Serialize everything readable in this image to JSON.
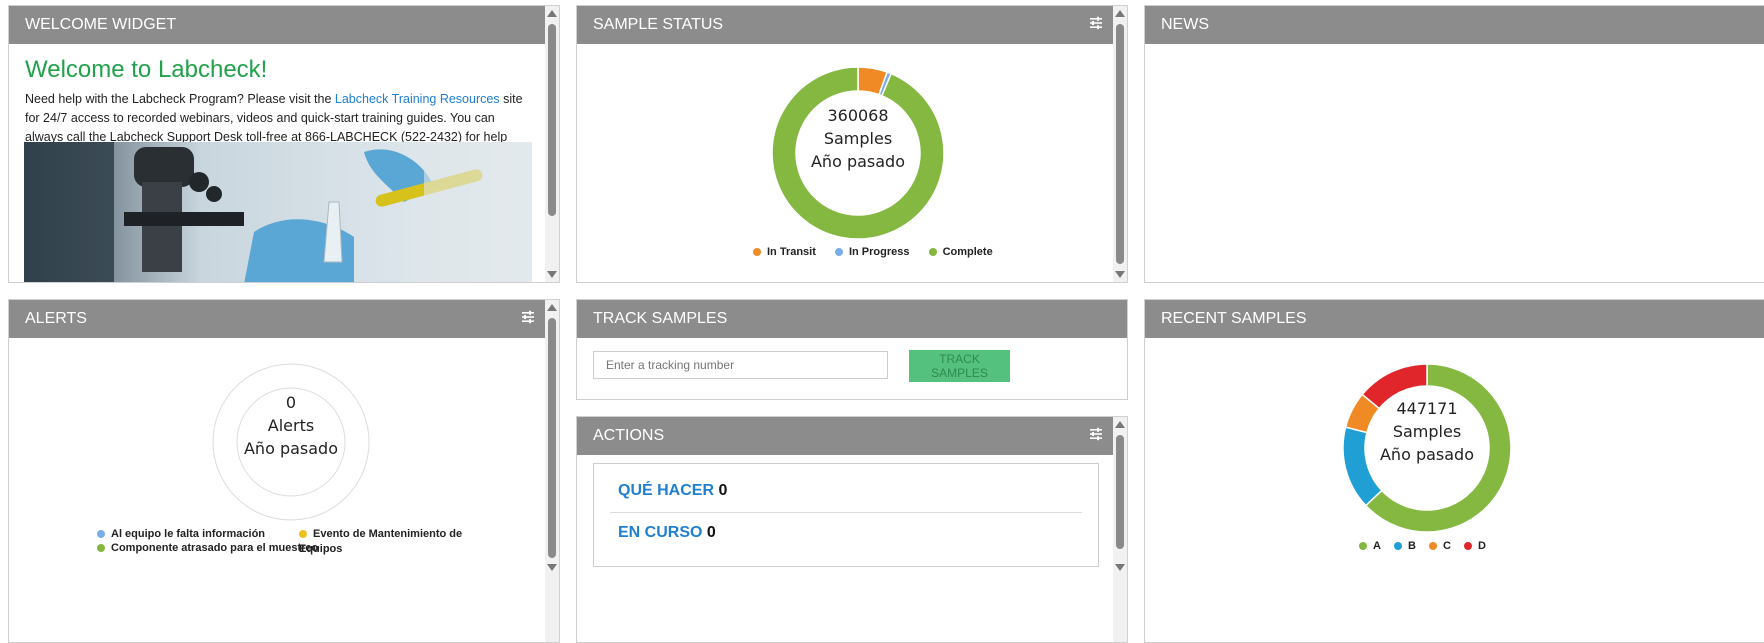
{
  "welcome": {
    "header": "WELCOME WIDGET",
    "title": "Welcome to Labcheck!",
    "text_before_link": "Need help with the Labcheck Program? Please visit the ",
    "link": "Labcheck Training Resources",
    "text_after_link": " site for 24/7 access to recorded webinars, videos and quick-start training guides. You can always call the Labcheck Support Desk toll-free at 866-LABCHECK (522-2432) for help with a personal touch. Thank you."
  },
  "sample_status": {
    "header": "SAMPLE STATUS",
    "count": "360068",
    "label": "Samples",
    "period": "Año pasado",
    "legend": [
      {
        "label": "In Transit",
        "color": "#f08a24"
      },
      {
        "label": "In Progress",
        "color": "#7aaee8"
      },
      {
        "label": "Complete",
        "color": "#84b840"
      }
    ]
  },
  "news": {
    "header": "NEWS"
  },
  "alerts": {
    "header": "ALERTS",
    "count": "0",
    "label": "Alerts",
    "period": "Año pasado",
    "legend": [
      {
        "label": "Al equipo le falta información",
        "color": "#7aaee8"
      },
      {
        "label": "Evento de Mantenimiento de Equipos",
        "color": "#f0c020"
      },
      {
        "label": "Componente atrasado para el muestreo",
        "color": "#84b840"
      }
    ]
  },
  "track": {
    "header": "TRACK SAMPLES",
    "placeholder": "Enter a tracking number",
    "button": "TRACK SAMPLES"
  },
  "actions": {
    "header": "ACTIONS",
    "rows": [
      {
        "label": "QUÉ HACER",
        "count": "0"
      },
      {
        "label": "EN CURSO",
        "count": "0"
      }
    ]
  },
  "recent": {
    "header": "RECENT SAMPLES",
    "count": "447171",
    "label": "Samples",
    "period": "Año pasado",
    "legend": [
      {
        "label": "A",
        "color": "#84b840"
      },
      {
        "label": "B",
        "color": "#1f9fd4"
      },
      {
        "label": "C",
        "color": "#f08a24"
      },
      {
        "label": "D",
        "color": "#e0262b"
      }
    ]
  },
  "chart_data": [
    {
      "type": "pie",
      "categories": [
        "In Transit",
        "In Progress",
        "Complete"
      ],
      "values": [
        5.5,
        0.8,
        93.7
      ]
    },
    {
      "type": "pie",
      "categories": [
        "Al equipo le falta información",
        "Evento de Mantenimiento de Equipos",
        "Componente atrasado para el muestreo"
      ],
      "values": [
        0,
        0,
        0
      ]
    },
    {
      "type": "pie",
      "categories": [
        "A",
        "B",
        "C",
        "D"
      ],
      "values": [
        63,
        16,
        7,
        14
      ]
    }
  ]
}
